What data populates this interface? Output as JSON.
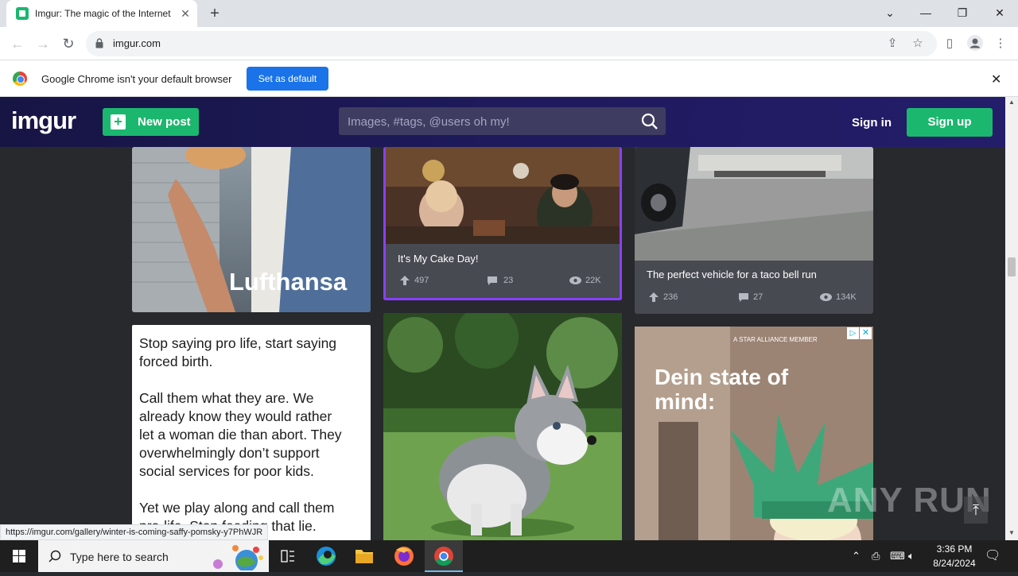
{
  "browser": {
    "tab_title": "Imgur: The magic of the Internet",
    "url": "imgur.com",
    "infobar_message": "Google Chrome isn't your default browser",
    "set_default_label": "Set as default",
    "status_url": "https://imgur.com/gallery/winter-is-coming-saffy-pomsky-y7PhWJR"
  },
  "imgur": {
    "logo": "imgur",
    "new_post_label": "New post",
    "search_placeholder": "Images, #tags, @users oh my!",
    "sign_in_label": "Sign in",
    "sign_up_label": "Sign up",
    "accent": "#1bb76e"
  },
  "posts": [
    {
      "title": "",
      "overlay_text": "Lufthansa"
    },
    {
      "title": "It's My Cake Day!",
      "upvotes": "497",
      "comments": "23",
      "views": "22K",
      "highlight": "#8a3ffc"
    },
    {
      "title": "The perfect vehicle for a taco bell run",
      "upvotes": "236",
      "comments": "27",
      "views": "134K"
    },
    {
      "text_lines": [
        "Stop saying pro life, start saying",
        "forced birth.",
        "",
        "Call them what they are. We",
        "already know they would rather",
        "let a woman die than abort. They",
        "overwhelmingly don’t support",
        "social services for poor kids.",
        "",
        "Yet we play along and call them",
        "pro-life. Stop feeding that lie."
      ]
    },
    {
      "title": "",
      "image": "husky puppy"
    },
    {
      "ad_headline": "Dein state of mind:",
      "ad_small": "A STAR ALLIANCE MEMBER"
    }
  ],
  "taskbar": {
    "search_placeholder": "Type here to search",
    "time": "3:36 PM",
    "date": "8/24/2024"
  },
  "watermark": "ANY RUN"
}
